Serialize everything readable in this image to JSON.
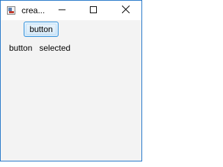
{
  "window": {
    "title": "crea..."
  },
  "controls": {
    "minimize_icon": "minimize-icon",
    "maximize_icon": "maximize-icon",
    "close_icon": "close-icon"
  },
  "main": {
    "button_label": "button",
    "status_text": "button   selected"
  }
}
